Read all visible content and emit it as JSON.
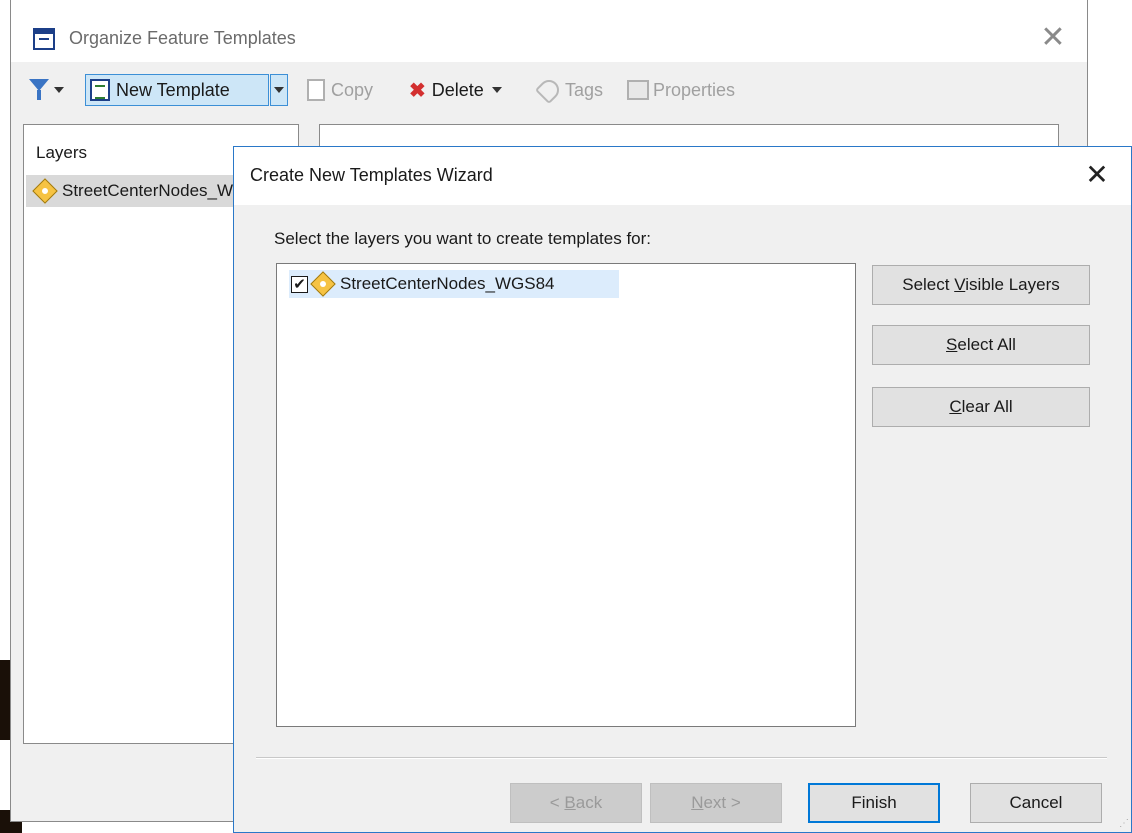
{
  "parent": {
    "title": "Organize Feature Templates",
    "toolbar": {
      "new_template": "New Template",
      "copy": "Copy",
      "delete": "Delete",
      "tags": "Tags",
      "properties": "Properties"
    },
    "layers_heading": "Layers",
    "layers": [
      "StreetCenterNodes_WGS84"
    ]
  },
  "wizard": {
    "title": "Create New Templates Wizard",
    "prompt": "Select the layers you want to create templates for:",
    "layer_items": [
      {
        "label": "StreetCenterNodes_WGS84",
        "checked": true
      }
    ],
    "buttons": {
      "select_visible_pre": "Select ",
      "select_visible_key": "V",
      "select_visible_post": "isible Layers",
      "select_all_key": "S",
      "select_all_post": "elect All",
      "clear_all_key": "C",
      "clear_all_post": "lear All"
    },
    "footer": {
      "back_pre": "< ",
      "back_key": "B",
      "back_post": "ack",
      "next_key": "N",
      "next_post": "ext >",
      "finish": "Finish",
      "cancel": "Cancel"
    }
  },
  "icons": {
    "close": "close-icon",
    "layer_symbol": "point-layer-icon",
    "checkbox": "checkbox-checked-icon"
  },
  "colors": {
    "accent": "#0078d7",
    "selection": "#dcecfc",
    "toolbar_active": "#cde6f7",
    "delete_red": "#d32f2f"
  }
}
